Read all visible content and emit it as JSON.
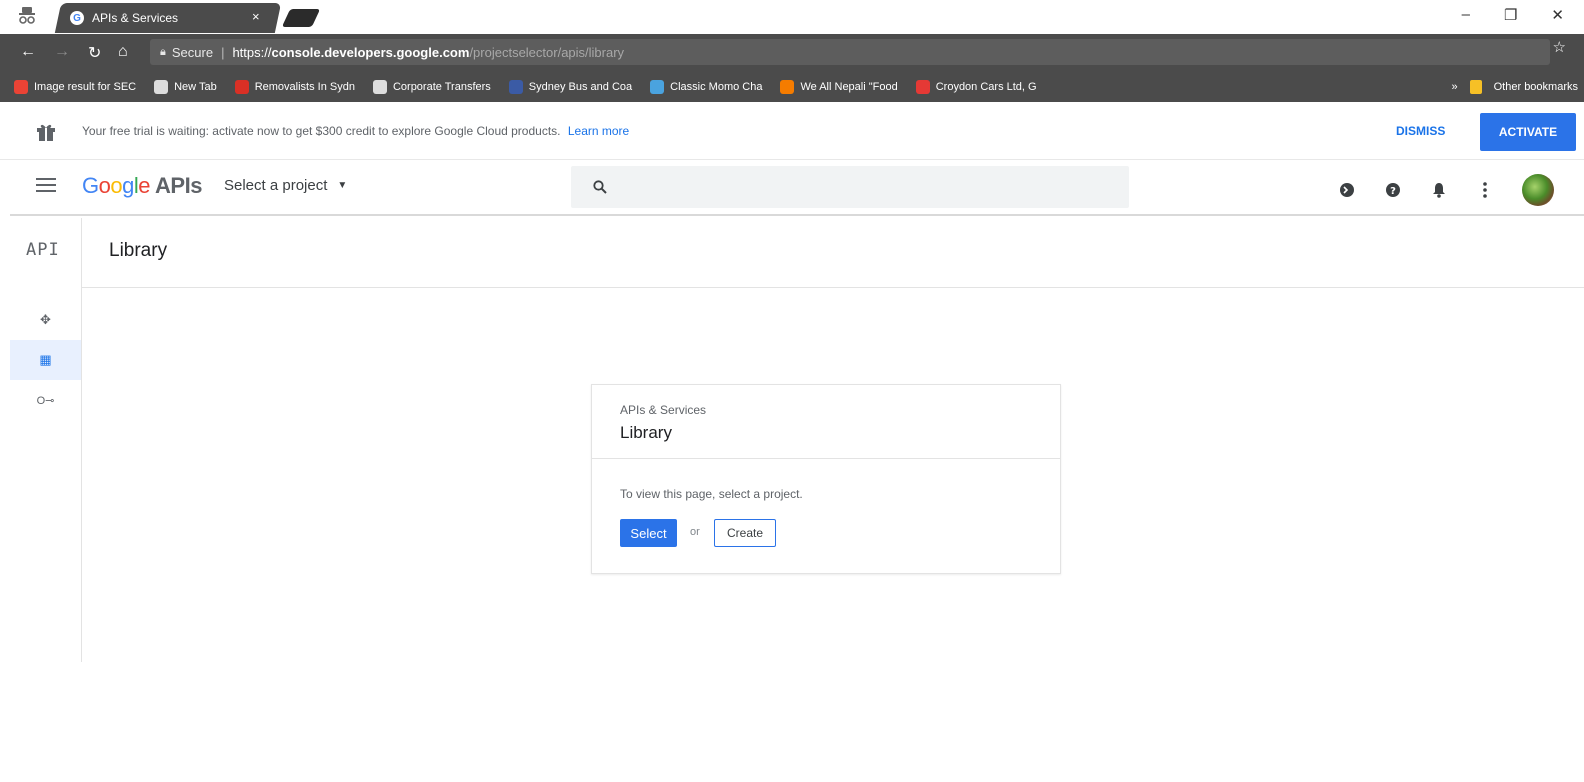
{
  "browser": {
    "tab": {
      "title": "APIs & Services",
      "close": "×"
    },
    "window_controls": {
      "minimize": "–",
      "restore": "❐",
      "close": "✕"
    },
    "address": {
      "secure_label": "Secure",
      "scheme": "https://",
      "host": "console.developers.google.com",
      "path": "/projectselector/apis/library"
    },
    "bookmarks": [
      {
        "label": "Image result for SEC",
        "icon_color": "#ea4335"
      },
      {
        "label": "New Tab",
        "icon_color": "#dddddd"
      },
      {
        "label": "Removalists In Sydn",
        "icon_color": "#d93025"
      },
      {
        "label": "Corporate Transfers",
        "icon_color": "#dddddd"
      },
      {
        "label": "Sydney Bus and Coa",
        "icon_color": "#3b5ba5"
      },
      {
        "label": "Classic Momo Cha",
        "icon_color": "#4aa3df"
      },
      {
        "label": "We All Nepali \"Food",
        "icon_color": "#f57c00"
      },
      {
        "label": "Croydon Cars Ltd, G",
        "icon_color": "#e53935"
      }
    ],
    "bookmarks_overflow": "»",
    "other_bookmarks": "Other bookmarks"
  },
  "banner": {
    "text": "Your free trial is waiting: activate now to get $300 credit to explore Google Cloud products.",
    "link": "Learn more",
    "dismiss": "DISMISS",
    "activate": "ACTIVATE"
  },
  "header": {
    "logo_letters": [
      "G",
      "o",
      "o",
      "g",
      "l",
      "e"
    ],
    "logo_suffix": "APIs",
    "project_selector": "Select a project",
    "icons": [
      "cloud-shell-icon",
      "help-icon",
      "notifications-icon",
      "more-vert-icon"
    ]
  },
  "rail": {
    "label": "API",
    "items": [
      {
        "icon": "dashboard-icon",
        "glyph": "✥",
        "active": false
      },
      {
        "icon": "library-icon",
        "glyph": "▦",
        "active": true
      },
      {
        "icon": "credentials-icon",
        "glyph": "O⊸",
        "active": false
      }
    ]
  },
  "page": {
    "title": "Library"
  },
  "card": {
    "subtitle": "APIs & Services",
    "title": "Library",
    "message": "To view this page, select a project.",
    "select_label": "Select",
    "or_label": "or",
    "create_label": "Create"
  },
  "colors": {
    "accent": "#2b73e8",
    "chrome_dark": "#4b4b4b"
  }
}
